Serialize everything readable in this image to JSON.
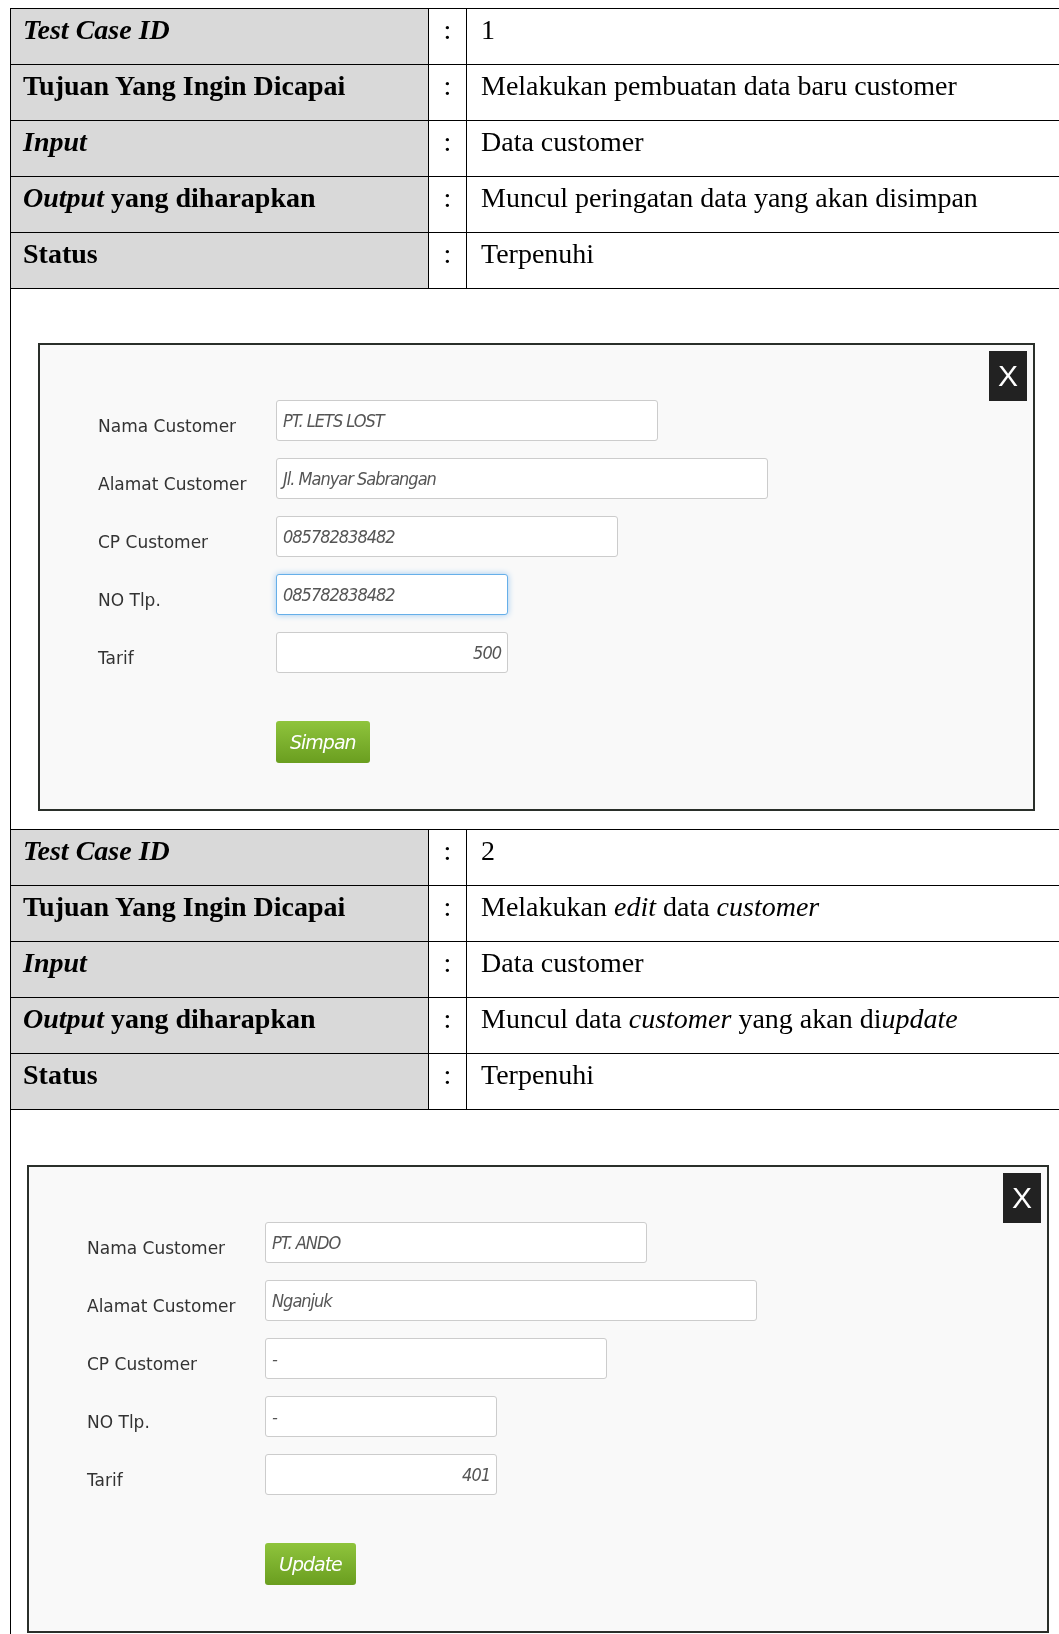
{
  "sections": [
    {
      "table": [
        {
          "label": "Test Case ID",
          "italic": true,
          "value": "1"
        },
        {
          "label": "Tujuan Yang Ingin Dicapai",
          "italic": false,
          "value": "Melakukan pembuatan data baru customer"
        },
        {
          "label": "Input",
          "italic": true,
          "value": "Data customer"
        },
        {
          "label": "*Output* yang diharapkan",
          "italic": false,
          "value": "Muncul peringatan data yang akan disimpan"
        },
        {
          "label": "Status",
          "italic": false,
          "value": "Terpenuhi"
        }
      ],
      "separator": ":",
      "form": {
        "close": "X",
        "fields": [
          {
            "label": "Nama Customer",
            "value": "PT. LETS LOST",
            "kind": "text",
            "focused": false
          },
          {
            "label": "Alamat Customer",
            "value": "Jl. Manyar Sabrangan",
            "kind": "text",
            "focused": false
          },
          {
            "label": "CP Customer",
            "value": "085782838482",
            "kind": "text",
            "focused": false
          },
          {
            "label": "NO Tlp.",
            "value": "085782838482",
            "kind": "text",
            "focused": true
          },
          {
            "label": "Tarif",
            "value": "500",
            "kind": "number",
            "focused": false
          }
        ],
        "button": "Simpan"
      }
    },
    {
      "table": [
        {
          "label": "Test Case ID",
          "italic": true,
          "value": "2"
        },
        {
          "label": "Tujuan Yang Ingin Dicapai",
          "italic": false,
          "value": "Melakukan *edit* data *customer*"
        },
        {
          "label": "Input",
          "italic": true,
          "value": "Data customer"
        },
        {
          "label": "*Output* yang diharapkan",
          "italic": false,
          "value": [
            {
              "text": "Muncul data ",
              "italic": false
            },
            {
              "text": "customer",
              "italic": true
            },
            {
              "text": " yang akan di",
              "italic": false
            },
            {
              "text": "update",
              "italic": true
            }
          ]
        },
        {
          "label": "Status",
          "italic": false,
          "value": "Terpenuhi"
        }
      ],
      "separator": ":",
      "form": {
        "close": "X",
        "fields": [
          {
            "label": "Nama Customer",
            "value": "PT. ANDO",
            "kind": "text",
            "focused": false
          },
          {
            "label": "Alamat Customer",
            "value": "Nganjuk",
            "kind": "text",
            "focused": false
          },
          {
            "label": "CP Customer",
            "value": "-",
            "kind": "text",
            "focused": false
          },
          {
            "label": "NO Tlp.",
            "value": "-",
            "kind": "text",
            "focused": false
          },
          {
            "label": "Tarif",
            "value": "401",
            "kind": "number",
            "focused": false
          }
        ],
        "button": "Update"
      }
    }
  ]
}
